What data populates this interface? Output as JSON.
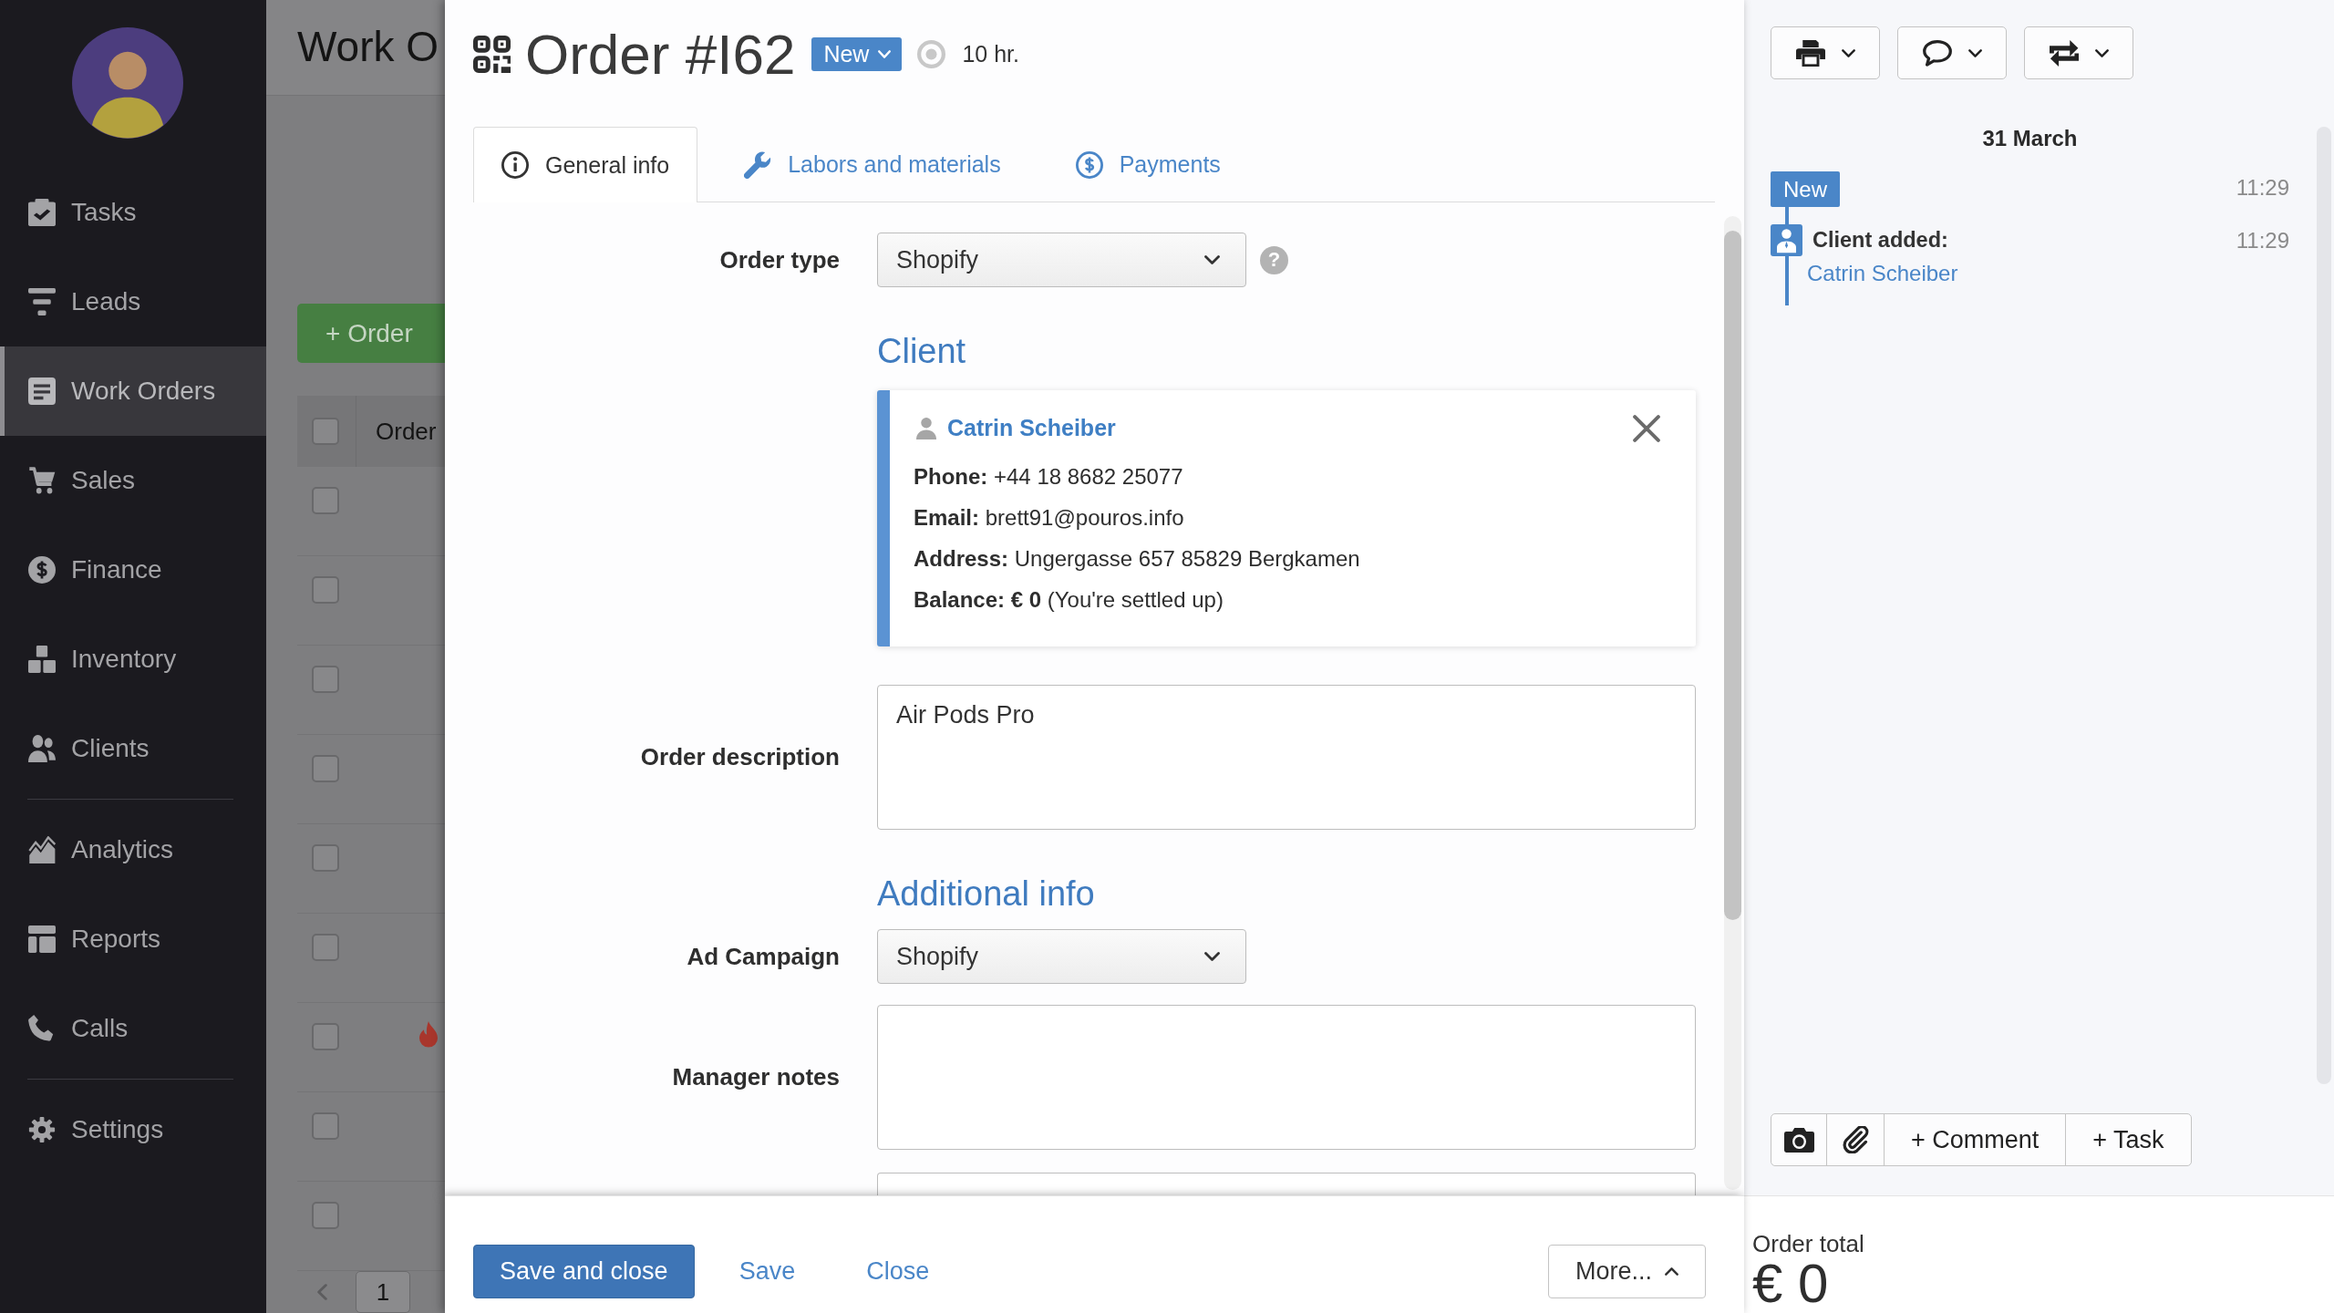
{
  "sidebar": {
    "sections": [
      {
        "items": [
          {
            "label": "Tasks",
            "selected": false
          },
          {
            "label": "Leads",
            "selected": false
          },
          {
            "label": "Work Orders",
            "selected": true
          },
          {
            "label": "Sales",
            "selected": false
          },
          {
            "label": "Finance",
            "selected": false
          },
          {
            "label": "Inventory",
            "selected": false
          },
          {
            "label": "Clients",
            "selected": false
          }
        ]
      },
      {
        "items": [
          {
            "label": "Analytics",
            "selected": false
          },
          {
            "label": "Reports",
            "selected": false
          },
          {
            "label": "Calls",
            "selected": false
          }
        ]
      },
      {
        "items": [
          {
            "label": "Settings",
            "selected": false
          }
        ]
      }
    ]
  },
  "background_page": {
    "title": "Work O",
    "add_button": "+ Order",
    "table": {
      "header_checkbox": {
        "checked": false
      },
      "columns": [
        "Order"
      ],
      "rows": [
        {
          "checked": false,
          "urgent": false
        },
        {
          "checked": false,
          "urgent": false
        },
        {
          "checked": false,
          "urgent": false
        },
        {
          "checked": false,
          "urgent": false
        },
        {
          "checked": false,
          "urgent": false
        },
        {
          "checked": false,
          "urgent": false
        },
        {
          "checked": false,
          "urgent": true
        },
        {
          "checked": false,
          "urgent": false
        },
        {
          "checked": false,
          "urgent": false
        }
      ]
    },
    "pagination": {
      "page": "1"
    }
  },
  "order": {
    "title": "Order #I62",
    "status": "New",
    "elapsed": "10 hr.",
    "tabs": [
      {
        "label": "General info",
        "selected": true
      },
      {
        "label": "Labors and materials",
        "selected": false
      },
      {
        "label": "Payments",
        "selected": false
      }
    ],
    "form": [
      {
        "kind": "select",
        "label": "Order type",
        "value": "Shopify",
        "help": "?"
      },
      {
        "kind": "heading",
        "text": "Client"
      },
      {
        "kind": "client_card",
        "name": "Catrin Scheiber",
        "details": [
          "**Phone:** +44 18 8682 25077",
          "**Email:** brett91@pouros.info",
          "**Address:** Ungergasse 657 85829 Bergkamen",
          "**Balance: € 0** (You're settled up)"
        ]
      },
      {
        "kind": "textarea",
        "label": "Order description",
        "value": "Air Pods Pro"
      },
      {
        "kind": "heading",
        "text": "Additional info"
      },
      {
        "kind": "select",
        "label": "Ad Campaign",
        "value": "Shopify"
      },
      {
        "kind": "textarea",
        "label": "Manager notes"
      },
      {
        "kind": "input"
      }
    ],
    "footer": {
      "buttons": [
        {
          "kind": "primary",
          "label": "Save and close"
        },
        {
          "kind": "link",
          "label": "Save"
        },
        {
          "kind": "link",
          "label": "Close"
        }
      ],
      "more": "More..."
    },
    "total": {
      "label": "Order total",
      "value": "€ 0"
    }
  },
  "history": {
    "date": "31 March",
    "events": [
      {
        "kind": "status",
        "label": "New",
        "time": "11:29"
      },
      {
        "kind": "client_added",
        "title": "Client added:",
        "link": "Catrin Scheiber",
        "time": "11:29"
      }
    ],
    "composer": [
      "+ Comment",
      "+ Task"
    ]
  }
}
